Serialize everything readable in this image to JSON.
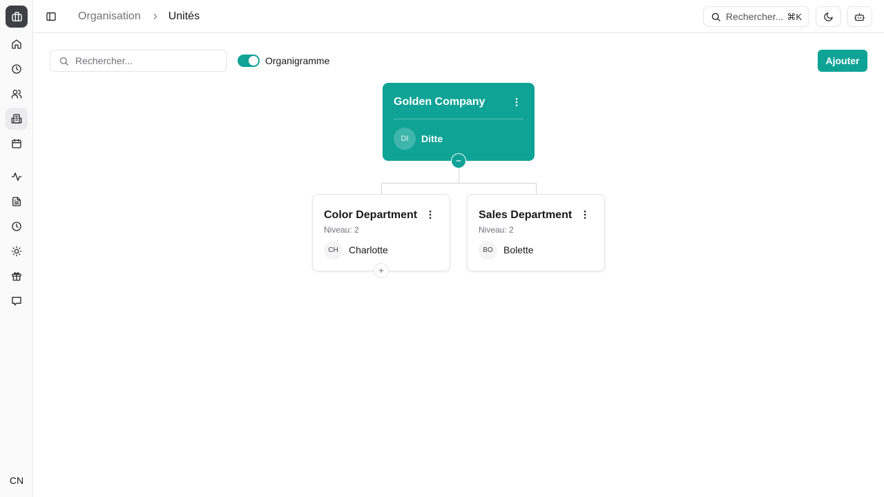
{
  "sidebar": {
    "items": [
      {
        "icon": "logo-icon"
      },
      {
        "icon": "home-icon"
      },
      {
        "icon": "clock-icon"
      },
      {
        "icon": "users-icon"
      },
      {
        "icon": "building-icon",
        "active": true
      },
      {
        "icon": "calendar-icon"
      },
      {
        "icon": "activity-icon"
      },
      {
        "icon": "document-icon"
      },
      {
        "icon": "history-icon"
      },
      {
        "icon": "sun-icon"
      },
      {
        "icon": "gift-icon"
      },
      {
        "icon": "message-icon"
      }
    ],
    "user_initials": "CN"
  },
  "header": {
    "breadcrumb": {
      "parent": "Organisation",
      "current": "Unités"
    },
    "search_label": "Rechercher...",
    "search_shortcut": "⌘K"
  },
  "toolbar": {
    "search_placeholder": "Rechercher...",
    "orgchart_label": "Organigramme",
    "orgchart_enabled": true,
    "add_label": "Ajouter"
  },
  "orgchart": {
    "root": {
      "name": "Golden Company",
      "manager_initials": "DI",
      "manager_name": "Ditte"
    },
    "children": [
      {
        "name": "Color Department",
        "level": "Niveau: 2",
        "manager_initials": "CH",
        "manager_name": "Charlotte"
      },
      {
        "name": "Sales Department",
        "level": "Niveau: 2",
        "manager_initials": "BO",
        "manager_name": "Bolette"
      }
    ]
  },
  "colors": {
    "accent": "#0fa396"
  }
}
